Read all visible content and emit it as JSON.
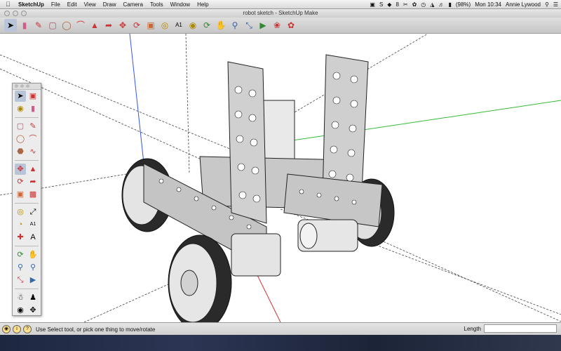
{
  "menubar": {
    "app_name": "SketchUp",
    "menus": [
      "File",
      "Edit",
      "View",
      "Draw",
      "Camera",
      "Tools",
      "Window",
      "Help"
    ],
    "battery": "(98%)",
    "clock": "Mon 10:34",
    "user": "Annie Lywood",
    "badge": "8"
  },
  "window": {
    "title": "robot sketch - SketchUp Make"
  },
  "toolbar": {
    "icons": [
      "select-icon",
      "eraser-icon",
      "pencil-icon",
      "rectangle-icon",
      "circle-icon",
      "arc-icon",
      "push-pull-icon",
      "follow-me-icon",
      "move-icon",
      "rotate-icon",
      "scale-icon",
      "tape-measure-icon",
      "text-icon",
      "paint-bucket-icon",
      "orbit-icon",
      "pan-icon",
      "zoom-icon",
      "zoom-extents-icon",
      "previous-view-icon",
      "warehouse-icon",
      "extension-icon"
    ]
  },
  "status": {
    "message": "Use Select tool, or pick one thing to move/rotate",
    "length_label": "Length",
    "length_value": ""
  },
  "colors": {
    "axis_blue": "#3355ee",
    "axis_green": "#33bb33",
    "axis_red": "#cc3333",
    "model_gray": "#c8c8c8"
  }
}
